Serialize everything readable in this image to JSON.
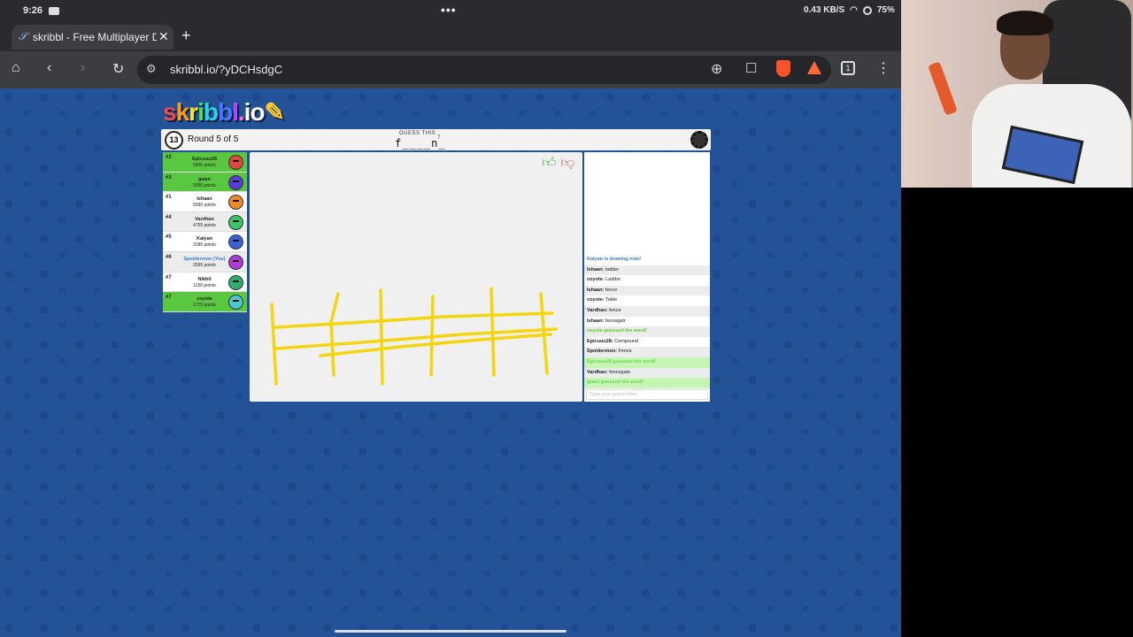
{
  "status_bar": {
    "time": "9:26",
    "network_speed": "0.43 KB/S",
    "battery": "75%"
  },
  "browser": {
    "tab_title": "skribbl - Free Multiplayer Dra",
    "new_tab": "+",
    "url": "skribbl.io/?yDCHsdgC",
    "tab_count": "1",
    "icons": [
      "home-icon",
      "back-icon",
      "forward-icon",
      "reload-icon",
      "site-settings-icon",
      "zoom-icon",
      "bookmark-icon",
      "brave-shield-icon",
      "brave-rewards-icon",
      "tabs-icon",
      "menu-icon"
    ]
  },
  "game": {
    "logo": "skribbl.io",
    "timer": "13",
    "round": "Round 5 of 5",
    "guess_label": "GUESS THIS",
    "word_hint": "f____n_",
    "word_length": "7",
    "players": [
      {
        "rank": "#2",
        "name": "Epicuuu28",
        "points": "5400 points",
        "status": "guessed",
        "color": "#e04a3a"
      },
      {
        "rank": "#3",
        "name": "gwen",
        "points": "5090 points",
        "status": "guessed",
        "color": "#5a3bd6"
      },
      {
        "rank": "#1",
        "name": "Ishaan",
        "points": "5990 points",
        "status": "normal",
        "color": "#ef8a2a"
      },
      {
        "rank": "#4",
        "name": "Vardhan",
        "points": "4755 points",
        "status": "normal",
        "color": "#3bc46a"
      },
      {
        "rank": "#5",
        "name": "Kalyan",
        "points": "3185 points",
        "status": "drawing",
        "color": "#3b62d6"
      },
      {
        "rank": "#6",
        "name": "Spoidermon (You)",
        "points": "2595 points",
        "status": "you",
        "color": "#b03bd6"
      },
      {
        "rank": "#7",
        "name": "Nikhil",
        "points": "1150 points",
        "status": "normal",
        "color": "#2fae6e"
      },
      {
        "rank": "#7",
        "name": "coyote",
        "points": "1775 points",
        "status": "guessed",
        "color": "#4ec6d0"
      }
    ],
    "chat": [
      {
        "type": "system-blue",
        "name": "",
        "text": "Kalyan is drawing now!"
      },
      {
        "type": "msg",
        "name": "Ishaan:",
        "text": "ladder"
      },
      {
        "type": "msg",
        "name": "coyote:",
        "text": "Ladder"
      },
      {
        "type": "msg",
        "name": "Ishaan:",
        "text": "fence"
      },
      {
        "type": "msg",
        "name": "coyote:",
        "text": "Table"
      },
      {
        "type": "msg",
        "name": "Vardhan:",
        "text": "fence"
      },
      {
        "type": "msg",
        "name": "Ishaan:",
        "text": "fencegatr"
      },
      {
        "type": "system-green",
        "name": "",
        "text": "coyote guessed the word!"
      },
      {
        "type": "msg",
        "name": "Epicuuu28:",
        "text": "Compound"
      },
      {
        "type": "msg",
        "name": "Spoidermon:",
        "text": "Fence"
      },
      {
        "type": "system-green-bg",
        "name": "",
        "text": "Epicuuu28 guessed the word!"
      },
      {
        "type": "msg",
        "name": "Vardhan:",
        "text": "fencegate"
      },
      {
        "type": "system-green-bg",
        "name": "",
        "text": "gwen guessed the word!"
      }
    ],
    "chat_placeholder": "Type your guess here...",
    "drawing_color": "#f5d60e",
    "background_color": "#235296"
  }
}
